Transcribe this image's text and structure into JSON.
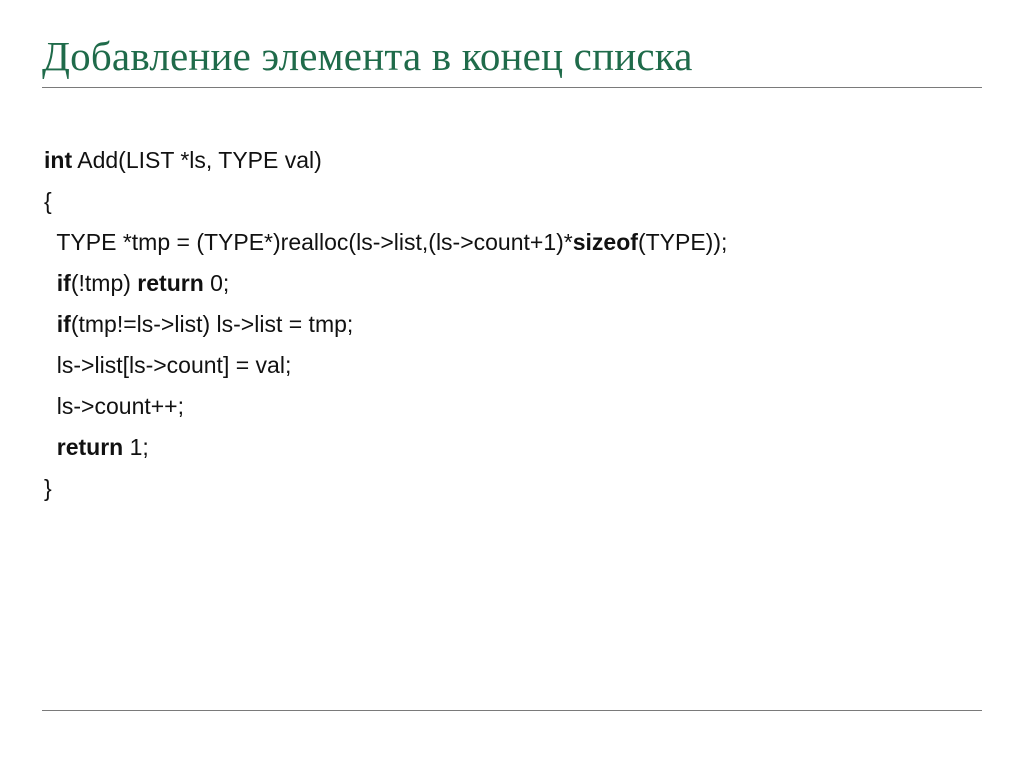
{
  "title": "Добавление элемента в конец списка",
  "code": {
    "kw_int": "int",
    "l1_rest": " Add(LIST *ls, TYPE val)",
    "l2": "{",
    "l3_pre": "  TYPE *tmp = (TYPE*)realloc(ls->list,(ls->count+1)*",
    "kw_sizeof": "sizeof",
    "l3_post": "(TYPE));",
    "l4_pre": "  ",
    "kw_if1": "if",
    "l4_mid": "(!tmp) ",
    "kw_return0": "return",
    "l4_post": " 0;",
    "l5_pre": "  ",
    "kw_if2": "if",
    "l5_rest": "(tmp!=ls->list) ls->list = tmp;",
    "l6": "  ls->list[ls->count] = val;",
    "l7": "  ls->count++;",
    "l8_pre": "  ",
    "kw_return1": "return",
    "l8_post": " 1;",
    "l9": "}"
  }
}
